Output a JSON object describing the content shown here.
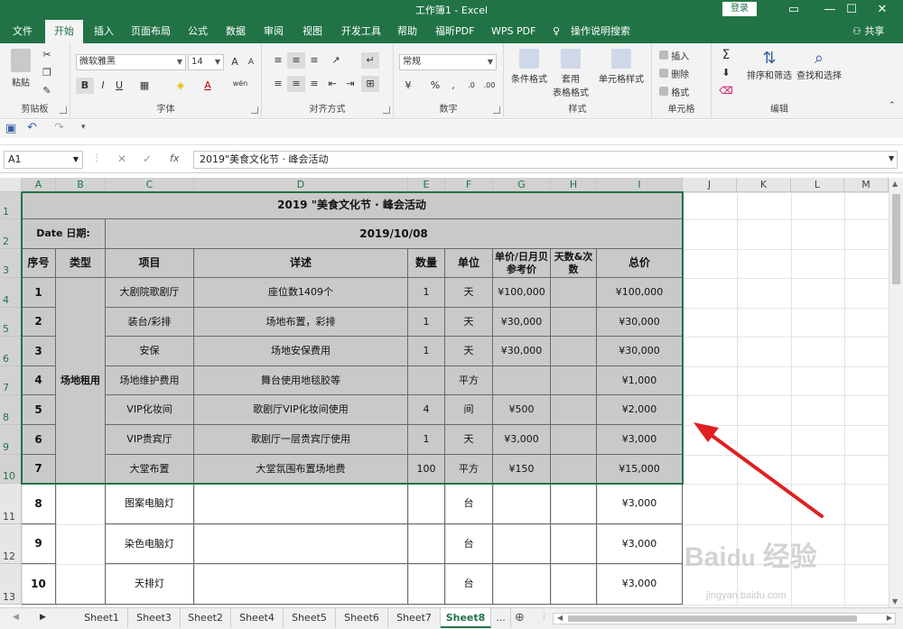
{
  "window": {
    "title": "工作簿1  -  Excel",
    "login": "登录",
    "share": "共享"
  },
  "menu": [
    "文件",
    "开始",
    "插入",
    "页面布局",
    "公式",
    "数据",
    "审阅",
    "视图",
    "开发工具",
    "帮助",
    "福昕PDF",
    "WPS PDF",
    "操作说明搜索"
  ],
  "ribbon": {
    "clipboard": {
      "label": "剪贴板",
      "paste": "粘贴"
    },
    "font": {
      "label": "字体",
      "name": "微软雅黑",
      "size": "14",
      "grow": "A",
      "shrink": "A",
      "bold": "B",
      "italic": "I",
      "underline": "U",
      "font_color": "A",
      "wen": "wén"
    },
    "align": {
      "label": "对齐方式"
    },
    "number": {
      "label": "数字",
      "format": "常规",
      "pct": "%",
      "comma": ","
    },
    "styles": {
      "label": "样式",
      "conditional": "条件格式",
      "table1": "套用",
      "table2": "表格格式",
      "cell": "单元格样式"
    },
    "cells": {
      "label": "单元格",
      "insert": "插入",
      "delete": "删除",
      "format": "格式"
    },
    "edit": {
      "label": "编辑",
      "sum": "Σ",
      "sort": "排序和筛选",
      "find": "查找和选择"
    }
  },
  "formula_bar": {
    "name": "A1",
    "fx": "fx",
    "content": "2019\"美食文化节 · 峰会活动"
  },
  "columns": [
    "A",
    "B",
    "C",
    "D",
    "E",
    "F",
    "G",
    "H",
    "I",
    "J",
    "K",
    "L",
    "M"
  ],
  "rows": [
    "1",
    "2",
    "3",
    "4",
    "5",
    "6",
    "7",
    "8",
    "9",
    "10",
    "11",
    "12",
    "13"
  ],
  "sheet": {
    "title": "2019 \"美食文化节 · 峰会活动",
    "date_label": "Date   日期:",
    "date_value": "2019/10/08",
    "headers": {
      "no": "序号",
      "type": "类型",
      "item": "项目",
      "detail": "详述",
      "qty": "数量",
      "unit": "单位",
      "price": "单价/日月贝参考价",
      "days": "天数&次数",
      "total": "总价"
    },
    "venue": "场地租用",
    "rows": [
      {
        "no": "1",
        "item": "大剧院歌剧厅",
        "detail": "座位数1409个",
        "qty": "1",
        "unit": "天",
        "price": "¥100,000",
        "days": "",
        "total": "¥100,000"
      },
      {
        "no": "2",
        "item": "装台/彩排",
        "detail": "场地布置，彩排",
        "qty": "1",
        "unit": "天",
        "price": "¥30,000",
        "days": "",
        "total": "¥30,000"
      },
      {
        "no": "3",
        "item": "安保",
        "detail": "场地安保费用",
        "qty": "1",
        "unit": "天",
        "price": "¥30,000",
        "days": "",
        "total": "¥30,000"
      },
      {
        "no": "4",
        "item": "场地维护费用",
        "detail": "舞台使用地毯胶等",
        "qty": "",
        "unit": "平方",
        "price": "",
        "days": "",
        "total": "¥1,000"
      },
      {
        "no": "5",
        "item": "VIP化妆间",
        "detail": "歌剧厅VIP化妆间使用",
        "qty": "4",
        "unit": "间",
        "price": "¥500",
        "days": "",
        "total": "¥2,000"
      },
      {
        "no": "6",
        "item": "VIP贵宾厅",
        "detail": "歌剧厅一层贵宾厅使用",
        "qty": "1",
        "unit": "天",
        "price": "¥3,000",
        "days": "",
        "total": "¥3,000"
      },
      {
        "no": "7",
        "item": "大堂布置",
        "detail": "大堂氛围布置场地费",
        "qty": "100",
        "unit": "平方",
        "price": "¥150",
        "days": "",
        "total": "¥15,000"
      },
      {
        "no": "8",
        "item": "图案电脑灯",
        "detail": "",
        "qty": "",
        "unit": "台",
        "price": "",
        "days": "",
        "total": "¥3,000"
      },
      {
        "no": "9",
        "item": "染色电脑灯",
        "detail": "",
        "qty": "",
        "unit": "台",
        "price": "",
        "days": "",
        "total": "¥3,000"
      },
      {
        "no": "10",
        "item": "天排灯",
        "detail": "",
        "qty": "",
        "unit": "台",
        "price": "",
        "days": "",
        "total": "¥3,000"
      }
    ]
  },
  "sheet_tabs": [
    "Sheet1",
    "Sheet3",
    "Sheet2",
    "Sheet4",
    "Sheet5",
    "Sheet6",
    "Sheet7",
    "Sheet8",
    "..."
  ],
  "active_sheet": "Sheet8",
  "watermark": {
    "main": "Bai du 经验",
    "sub": "jingyan.baidu.com"
  }
}
